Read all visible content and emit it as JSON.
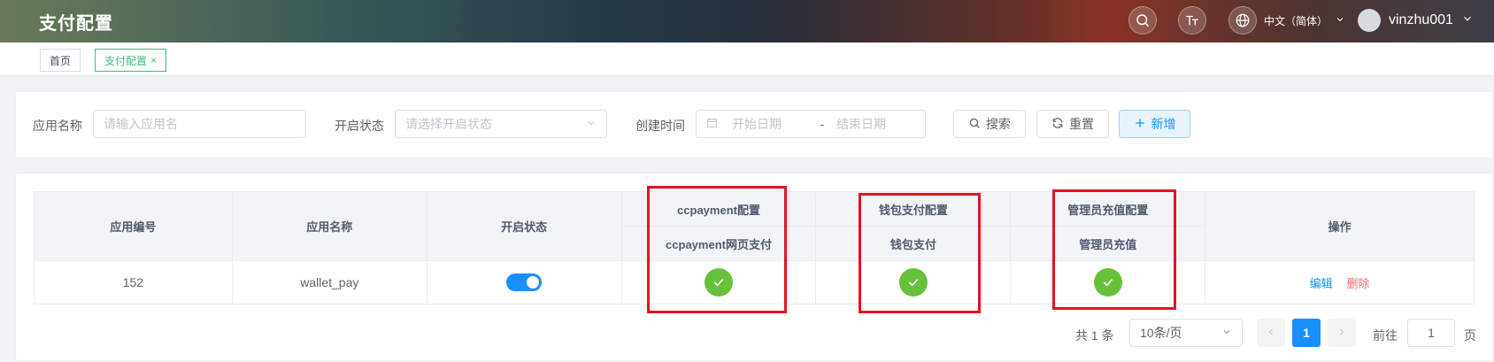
{
  "header": {
    "title": "支付配置",
    "language": "中文（简体）",
    "username": "vinzhu001"
  },
  "tabs": [
    {
      "label": "首页"
    },
    {
      "label": "支付配置",
      "close": "×"
    }
  ],
  "filters": {
    "app_name_label": "应用名称",
    "app_name_placeholder": "请输入应用名",
    "status_label": "开启状态",
    "status_placeholder": "请选择开启状态",
    "created_label": "创建时间",
    "start_placeholder": "开始日期",
    "range_sep": "-",
    "end_placeholder": "结束日期",
    "search_button": "搜索",
    "reset_button": "重置",
    "add_button": "新增"
  },
  "table": {
    "headers": {
      "app_id": "应用编号",
      "app_name": "应用名称",
      "status": "开启状态",
      "ccpayment_group": "ccpayment配置",
      "ccpayment_web": "ccpayment网页支付",
      "wallet_group": "钱包支付配置",
      "wallet_pay": "钱包支付",
      "admin_group": "管理员充值配置",
      "admin_recharge": "管理员充值",
      "actions": "操作"
    },
    "rows": [
      {
        "app_id": "152",
        "app_name": "wallet_pay",
        "status_on": true,
        "ccpayment_web": true,
        "wallet_pay": true,
        "admin_recharge": true,
        "edit": "编辑",
        "delete": "删除"
      }
    ]
  },
  "pagination": {
    "total": "共 1 条",
    "page_size": "10条/页",
    "current_page": "1",
    "goto_label": "前往",
    "goto_value": "1",
    "page_suffix": "页"
  },
  "colors": {
    "primary": "#1890ff",
    "success": "#67c23a",
    "danger": "#f56c6c",
    "highlight": "#e0161f",
    "tab_active": "#42b983"
  }
}
